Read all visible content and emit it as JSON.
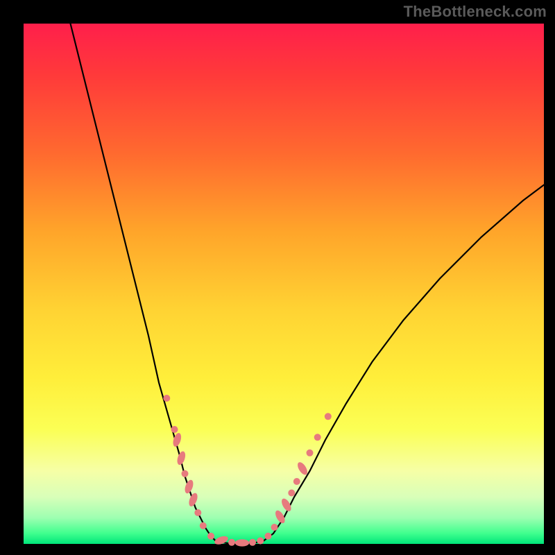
{
  "watermark": "TheBottleneck.com",
  "colors": {
    "background": "#000000",
    "gradient_top": "#ff1f4b",
    "gradient_mid": "#ffd333",
    "gradient_bottom": "#00e57a",
    "curve": "#000000",
    "marker": "#e77a7e"
  },
  "chart_data": {
    "type": "line",
    "title": "",
    "xlabel": "",
    "ylabel": "",
    "xlim": [
      0,
      100
    ],
    "ylim": [
      0,
      100
    ],
    "series": [
      {
        "name": "left_curve",
        "x": [
          9,
          12,
          15,
          18,
          21,
          24,
          26,
          28,
          30,
          31,
          32,
          33,
          34,
          35,
          36,
          37
        ],
        "y": [
          100,
          88,
          76,
          64,
          52,
          40,
          31,
          24,
          17,
          13,
          10,
          7,
          5,
          3,
          1.5,
          0.5
        ]
      },
      {
        "name": "valley_floor",
        "x": [
          37,
          40,
          43,
          46
        ],
        "y": [
          0.5,
          0,
          0,
          0.5
        ]
      },
      {
        "name": "right_curve",
        "x": [
          46,
          48,
          50,
          52,
          55,
          58,
          62,
          67,
          73,
          80,
          88,
          96,
          100
        ],
        "y": [
          0.5,
          2,
          5,
          9,
          14,
          20,
          27,
          35,
          43,
          51,
          59,
          66,
          69
        ]
      }
    ],
    "markers": [
      {
        "x": 27.5,
        "y": 28,
        "r": 1.2
      },
      {
        "x": 29.0,
        "y": 22,
        "r": 1.2
      },
      {
        "x": 29.5,
        "y": 20,
        "r": 1.3,
        "elongated": true,
        "angle": -72
      },
      {
        "x": 30.3,
        "y": 16.5,
        "r": 1.3,
        "elongated": true,
        "angle": -72
      },
      {
        "x": 31.0,
        "y": 13.5,
        "r": 1.2
      },
      {
        "x": 31.8,
        "y": 11,
        "r": 1.3,
        "elongated": true,
        "angle": -70
      },
      {
        "x": 32.6,
        "y": 8.5,
        "r": 1.3,
        "elongated": true,
        "angle": -68
      },
      {
        "x": 33.5,
        "y": 6,
        "r": 1.2
      },
      {
        "x": 34.5,
        "y": 3.5,
        "r": 1.2
      },
      {
        "x": 36.0,
        "y": 1.5,
        "r": 1.2
      },
      {
        "x": 38.0,
        "y": 0.7,
        "r": 1.3,
        "elongated": true,
        "angle": -20
      },
      {
        "x": 40.0,
        "y": 0.3,
        "r": 1.2
      },
      {
        "x": 42.0,
        "y": 0.2,
        "r": 1.3,
        "elongated": true,
        "angle": 0
      },
      {
        "x": 44.0,
        "y": 0.3,
        "r": 1.2
      },
      {
        "x": 45.5,
        "y": 0.6,
        "r": 1.2
      },
      {
        "x": 47.0,
        "y": 1.5,
        "r": 1.2
      },
      {
        "x": 48.2,
        "y": 3.2,
        "r": 1.2
      },
      {
        "x": 49.3,
        "y": 5.2,
        "r": 1.3,
        "elongated": true,
        "angle": 60
      },
      {
        "x": 50.5,
        "y": 7.5,
        "r": 1.3,
        "elongated": true,
        "angle": 60
      },
      {
        "x": 51.5,
        "y": 9.8,
        "r": 1.2
      },
      {
        "x": 52.5,
        "y": 12,
        "r": 1.2
      },
      {
        "x": 53.6,
        "y": 14.5,
        "r": 1.3,
        "elongated": true,
        "angle": 58
      },
      {
        "x": 55.0,
        "y": 17.5,
        "r": 1.2
      },
      {
        "x": 56.5,
        "y": 20.5,
        "r": 1.2
      },
      {
        "x": 58.5,
        "y": 24.5,
        "r": 1.2
      }
    ]
  }
}
